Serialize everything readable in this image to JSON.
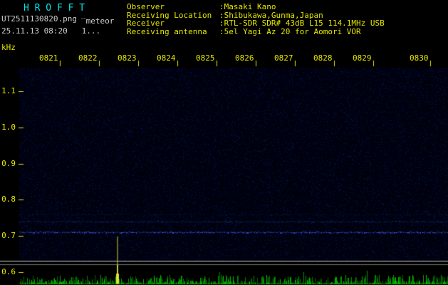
{
  "header": {
    "app_title": "H R O F F T",
    "filename": "UT2511130820.png",
    "mode_label": "‾meteor",
    "datetime_line": "25.11.13 08:20   1...",
    "info_rows": [
      {
        "label": "Observer",
        "value": ":Masaki Kano"
      },
      {
        "label": "Receiving Location",
        "value": ":Shibukawa,Gunma,Japan"
      },
      {
        "label": "Receiver",
        "value": ":RTL-SDR SDR# 43dB L15 114.1MHz USB"
      },
      {
        "label": "Receiving antenna",
        "value": ":5el Yagi Az 20 for Aomori VOR"
      }
    ]
  },
  "chart_data": {
    "type": "heatmap",
    "title": "HROFFT 10-minute radio meteor observation spectrogram 08:20-08:30 UT, 2025-11-13",
    "ylabel": "kHz",
    "x_tick_labels": [
      "0821",
      "0822",
      "0823",
      "0824",
      "0825",
      "0826",
      "0827",
      "0828",
      "0829",
      "0830"
    ],
    "y_tick_labels": [
      "1.1",
      "1.0",
      "0.9",
      "0.8",
      "0.7",
      "0.6"
    ],
    "y_tick_values": [
      1.1,
      1.0,
      0.9,
      0.8,
      0.7,
      0.6
    ],
    "y_range_khz": [
      0.6,
      1.17
    ],
    "grid": "off",
    "legend": "off",
    "signals": [
      {
        "name": "carrier-line-strong",
        "freq_khz": 0.71,
        "intensity": 0.9,
        "color": "#3C64FF",
        "extent": "full width 0820-0830"
      },
      {
        "name": "carrier-line-weak",
        "freq_khz": 0.74,
        "intensity": 0.45,
        "color": "#2850D2",
        "extent": "full width 0820-0830"
      },
      {
        "name": "carrier-line-faint",
        "freq_khz": 0.76,
        "intensity": 0.18,
        "color": "#1E3CB4",
        "extent": "full width 0820-0830"
      },
      {
        "name": "vertical-event-marker",
        "time_label": "0823",
        "intensity": 0.85,
        "color": "#D2D23C"
      }
    ],
    "noise_floor": {
      "background": "#000006",
      "speckle_color": "#1430B4"
    },
    "level_meter": {
      "trace_color": "#00C800",
      "baseline_color": "#006000",
      "event_spike_color": "#E6E632"
    }
  },
  "colors": {
    "background": "#000000",
    "title_cyan": "#00E6E6",
    "text_gray": "#D0D0D0",
    "axis_yellow": "#E6E600",
    "separator_bright": "#C8C8C8",
    "separator_dim": "#787878"
  }
}
